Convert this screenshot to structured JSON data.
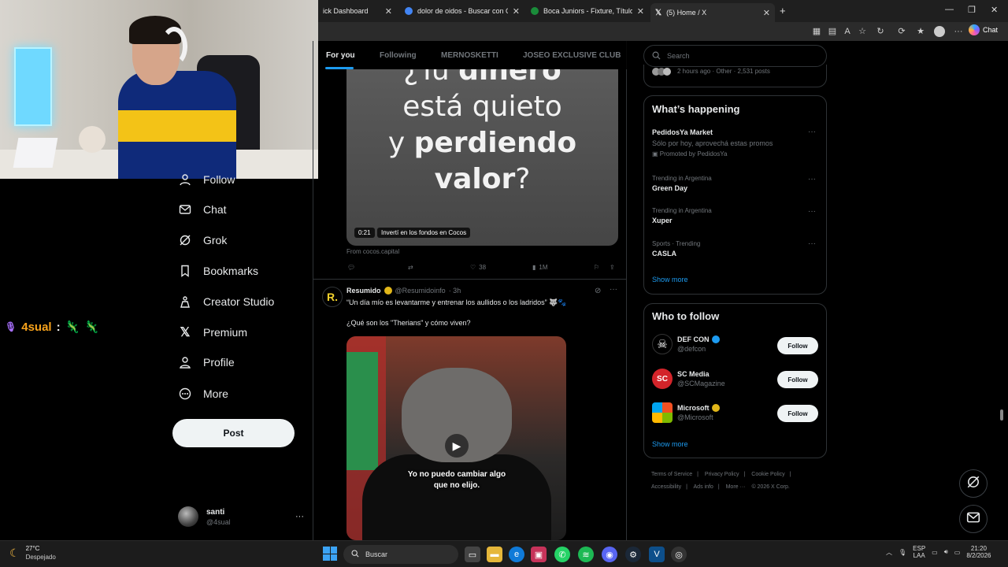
{
  "browser": {
    "tabs": [
      {
        "title": "ick Dashboard",
        "favicon_color": "#555555"
      },
      {
        "title": "dolor de oidos - Buscar con Google",
        "favicon_color": "#4285f4"
      },
      {
        "title": "Boca Juniors - Fixture, Títulos y Pla",
        "favicon_color": "#1a8c3a"
      },
      {
        "title": "(5) Home / X",
        "favicon_color": "#ffffff",
        "active": true
      }
    ],
    "new_tab": "+",
    "copilot_label": "Chat"
  },
  "stream_chat": {
    "user": "4sual",
    "sep": ":",
    "emotes": [
      "🦎",
      "🦎"
    ]
  },
  "left_nav": {
    "items": [
      {
        "label": "Follow",
        "icon": "follow-icon"
      },
      {
        "label": "Chat",
        "icon": "mail-icon"
      },
      {
        "label": "Grok",
        "icon": "grok-icon"
      },
      {
        "label": "Bookmarks",
        "icon": "bookmark-icon"
      },
      {
        "label": "Creator Studio",
        "icon": "creator-studio-icon"
      },
      {
        "label": "Premium",
        "icon": "x-logo-icon"
      },
      {
        "label": "Profile",
        "icon": "person-icon"
      },
      {
        "label": "More",
        "icon": "more-circle-icon"
      }
    ],
    "post_button": "Post",
    "account": {
      "name": "santi",
      "handle": "@4sual",
      "more": "···"
    }
  },
  "feed": {
    "tabs": [
      "For you",
      "Following",
      "MERNOSKETTI",
      "JOSEO EXCLUSIVE CLUB"
    ],
    "ad": {
      "lines": [
        {
          "pre": "¿Tu ",
          "bold": "dinero",
          "post": ""
        },
        {
          "pre": "está quieto",
          "bold": "",
          "post": ""
        },
        {
          "pre": "y ",
          "bold": "perdiendo",
          "post": ""
        },
        {
          "pre": "",
          "bold": "valor",
          "post": "?"
        }
      ],
      "video_time": "0:21",
      "video_caption": "Invertí en los fondos en Cocos",
      "source": "From cocos.capital",
      "likes": "38",
      "views": "1M"
    },
    "post2": {
      "avatar_letter": "R.",
      "name": "Resumido",
      "handle": "@Resumidoinfo",
      "time": "· 3h",
      "text1": "“Un día mío es levantarme y entrenar los aullidos o los ladridos” 🐺🐾",
      "text2": "¿Qué son los \"Therians\" y cómo viven?",
      "subtitle1": "Yo no puedo cambiar algo",
      "subtitle2": "que no elijo."
    }
  },
  "right": {
    "search_placeholder": "Search",
    "spaces_meta": "2 hours ago · Other · 2,531 posts",
    "happening": {
      "title": "What’s happening",
      "items": [
        {
          "meta": "",
          "name": "PedidosYa Market",
          "desc": "Sólo por hoy, aprovechá estas promos",
          "promoted": "Promoted by PedidosYa"
        },
        {
          "meta": "Trending in Argentina",
          "name": "Green Day"
        },
        {
          "meta": "Trending in Argentina",
          "name": "Xuper"
        },
        {
          "meta": "Sports · Trending",
          "name": "CASLA"
        }
      ],
      "show_more": "Show more"
    },
    "who_to_follow": {
      "title": "Who to follow",
      "accounts": [
        {
          "name": "DEF CON",
          "handle": "@defcon",
          "badge": "blue"
        },
        {
          "name": "SC Media",
          "handle": "@SCMagazine",
          "badge": ""
        },
        {
          "name": "Microsoft",
          "handle": "@Microsoft",
          "badge": "gold"
        }
      ],
      "follow_label": "Follow",
      "show_more": "Show more"
    },
    "footer": [
      "Terms of Service",
      "|",
      "Privacy Policy",
      "|",
      "Cookie Policy",
      "|",
      "Accessibility",
      "|",
      "Ads info",
      "|",
      "More ···",
      "© 2026 X Corp."
    ]
  },
  "taskbar": {
    "weather_temp": "27°C",
    "weather_desc": "Despejado",
    "search_label": "Buscar",
    "lang1": "ESP",
    "lang2": "LAA",
    "time": "21:20",
    "date": "8/2/2026"
  }
}
